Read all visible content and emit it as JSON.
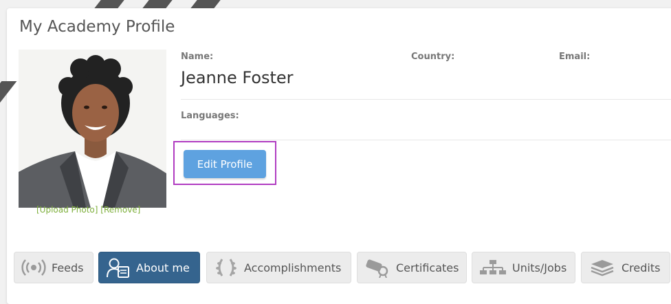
{
  "profile": {
    "title": "My Academy Profile",
    "labels": {
      "name": "Name:",
      "country": "Country:",
      "email": "Email:",
      "languages": "Languages:"
    },
    "name_value": "Jeanne Foster",
    "photo_links": {
      "upload": "[Upload Photo]",
      "remove": "[Remove]"
    },
    "edit_button": "Edit Profile"
  },
  "tabs": [
    {
      "label": "Feeds",
      "icon": "feeds-icon",
      "active": false
    },
    {
      "label": "About me",
      "icon": "about-me-icon",
      "active": true
    },
    {
      "label": "Accomplishments",
      "icon": "laurel-icon",
      "active": false
    },
    {
      "label": "Certificates",
      "icon": "certificate-icon",
      "active": false
    },
    {
      "label": "Units/Jobs",
      "icon": "org-chart-icon",
      "active": false
    },
    {
      "label": "Credits",
      "icon": "credits-stack-icon",
      "active": false
    }
  ],
  "colors": {
    "accent": "#5ea2e0",
    "active_tab": "#35648e",
    "highlight": "#b03bc1",
    "link": "#7cae3a"
  }
}
